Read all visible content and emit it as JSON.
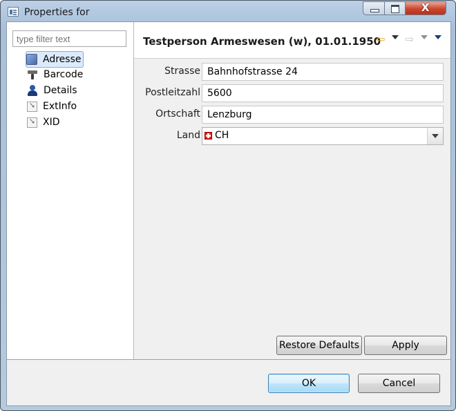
{
  "window": {
    "title": "Properties for",
    "minimize_icon": "minimize-icon",
    "maximize_icon": "maximize-icon",
    "close_icon": "close-icon",
    "close_glyph": "X"
  },
  "tree": {
    "filter_placeholder": "type filter text",
    "items": [
      {
        "label": "Adresse",
        "icon": "address-book-icon",
        "selected": true
      },
      {
        "label": "Barcode",
        "icon": "barcode-scanner-icon"
      },
      {
        "label": "Details",
        "icon": "person-icon"
      },
      {
        "label": "ExtInfo",
        "icon": "link-arrow-icon"
      },
      {
        "label": "XID",
        "icon": "link-arrow-icon"
      }
    ]
  },
  "page": {
    "title": "Testperson Armeswesen (w), 01.01.1950",
    "back_icon": "back-arrow-icon",
    "forward_icon": "forward-arrow-icon",
    "menu_icon": "view-menu-icon"
  },
  "form": {
    "strasse_label": "Strasse",
    "strasse_value": "Bahnhofstrasse 24",
    "plz_label": "Postleitzahl",
    "plz_value": "5600",
    "ort_label": "Ortschaft",
    "ort_value": "Lenzburg",
    "land_label": "Land",
    "land_value": "CH",
    "land_flag": "swiss-flag-icon"
  },
  "buttons": {
    "restore": "Restore Defaults",
    "apply": "Apply",
    "ok": "OK",
    "cancel": "Cancel"
  },
  "colors": {
    "title_gradient": "#a8c0da",
    "selection": "#dcebfc",
    "ok_button": "#bee6fd"
  }
}
